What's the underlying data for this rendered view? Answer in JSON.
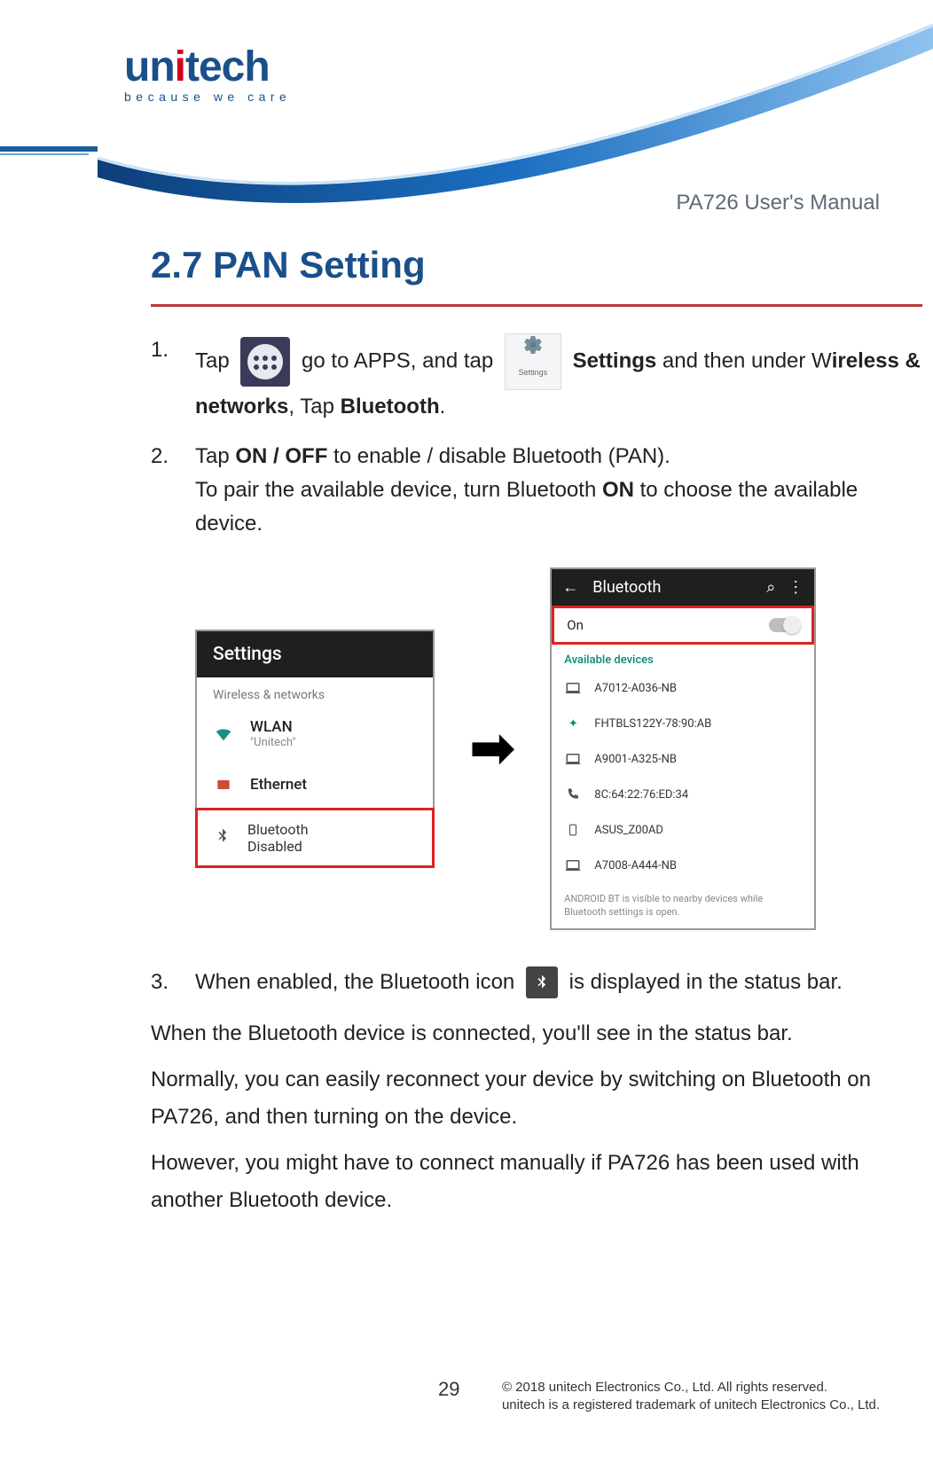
{
  "logo": {
    "tagline": "because we care"
  },
  "doc_title": "PA726 User's Manual",
  "section_title": "2.7 PAN Setting",
  "steps": {
    "s1": {
      "num": "1.",
      "t1": "Tap",
      "t2": "go to APPS, and tap",
      "t3a": "Settings",
      "t3b": " and then under W",
      "t3c": "ireless & networks",
      "t3d": ", Tap ",
      "t3e": "Bluetooth",
      "t3f": "."
    },
    "s2": {
      "num": "2.",
      "l1a": "Tap ",
      "l1b": "ON / OFF",
      "l1c": " to enable / disable Bluetooth (PAN).",
      "l2a": "To pair the available device, turn Bluetooth ",
      "l2b": "ON",
      "l2c": " to choose the available device."
    },
    "s3": {
      "num": "3.",
      "t1": "When enabled, the Bluetooth icon",
      "t2": "is displayed in the status bar."
    }
  },
  "screens": {
    "settings_label": "Settings",
    "a": {
      "header": "Settings",
      "subhead": "Wireless & networks",
      "wlan": "WLAN",
      "wlan_sub": "\"Unitech\"",
      "eth": "Ethernet",
      "bt": "Bluetooth",
      "bt_sub": "Disabled"
    },
    "b": {
      "title": "Bluetooth",
      "on": "On",
      "avail": "Available devices",
      "d1": "A7012-A036-NB",
      "d2": "FHTBLS122Y-78:90:AB",
      "d3": "A9001-A325-NB",
      "d4": "8C:64:22:76:ED:34",
      "d5": "ASUS_Z00AD",
      "d6": "A7008-A444-NB",
      "note": "ANDROID BT is visible to nearby devices while Bluetooth settings is open."
    }
  },
  "paras": {
    "p1": "When the Bluetooth device is connected, you'll see in the status bar.",
    "p2": "Normally, you can easily reconnect your device by switching on Bluetooth on PA726, and then turning on the device.",
    "p3": "However, you might have to connect manually if PA726 has been used with another Bluetooth device."
  },
  "footer": {
    "page": "29",
    "c1": "© 2018 unitech Electronics Co., Ltd. All rights reserved.",
    "c2": "unitech is a registered trademark of unitech Electronics Co., Ltd."
  }
}
